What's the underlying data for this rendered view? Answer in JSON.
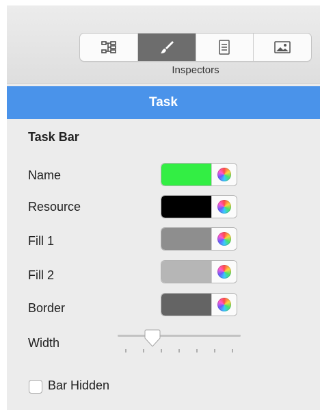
{
  "toolbar": {
    "label": "Inspectors",
    "buttons": [
      {
        "icon": "outline-icon",
        "active": false
      },
      {
        "icon": "brush-icon",
        "active": true
      },
      {
        "icon": "document-icon",
        "active": false
      },
      {
        "icon": "image-icon",
        "active": false
      }
    ]
  },
  "section": {
    "title": "Task"
  },
  "task_bar": {
    "title": "Task Bar",
    "rows": [
      {
        "label": "Name",
        "color": "#33ee44"
      },
      {
        "label": "Resource",
        "color": "#000000"
      },
      {
        "label": "Fill 1",
        "color": "#8e8e8e"
      },
      {
        "label": "Fill 2",
        "color": "#b6b6b6"
      },
      {
        "label": "Border",
        "color": "#646464"
      }
    ],
    "width": {
      "label": "Width",
      "value_fraction": 0.25,
      "ticks": 7
    },
    "bar_hidden": {
      "label": "Bar Hidden",
      "checked": false
    }
  }
}
